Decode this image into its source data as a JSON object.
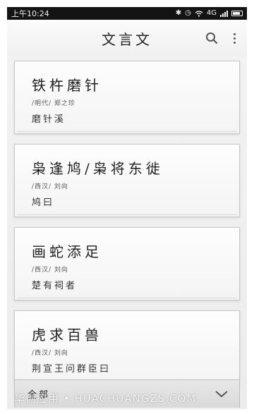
{
  "status": {
    "time": "上午10:24",
    "network": "4G"
  },
  "appbar": {
    "title": "文言文"
  },
  "cards": [
    {
      "title": "铁杵磨针",
      "meta": "/明代/ 郑之珍",
      "subtitle": "磨针溪"
    },
    {
      "title": "枭逢鸠/枭将东徙",
      "meta": "/西汉/ 刘向",
      "subtitle": "鸠曰"
    },
    {
      "title": "画蛇添足",
      "meta": "/西汉/ 刘向",
      "subtitle": "楚有祠者"
    },
    {
      "title": "虎求百兽",
      "meta": "/西汉/ 刘向",
      "subtitle": "荆宣王问群臣曰"
    }
  ],
  "bottom": {
    "filter_label": "全部"
  },
  "watermark": {
    "text": "华创应用 • HUACHUANGZS.COM"
  },
  "colors": {
    "statusbar": "#141414",
    "background": "#eeeeee",
    "card": "#f8f8f8",
    "text": "#1e1e1e"
  },
  "icons": {
    "search": "search-icon",
    "more": "more-vertical-icon",
    "dropdown": "chevron-down-icon"
  }
}
